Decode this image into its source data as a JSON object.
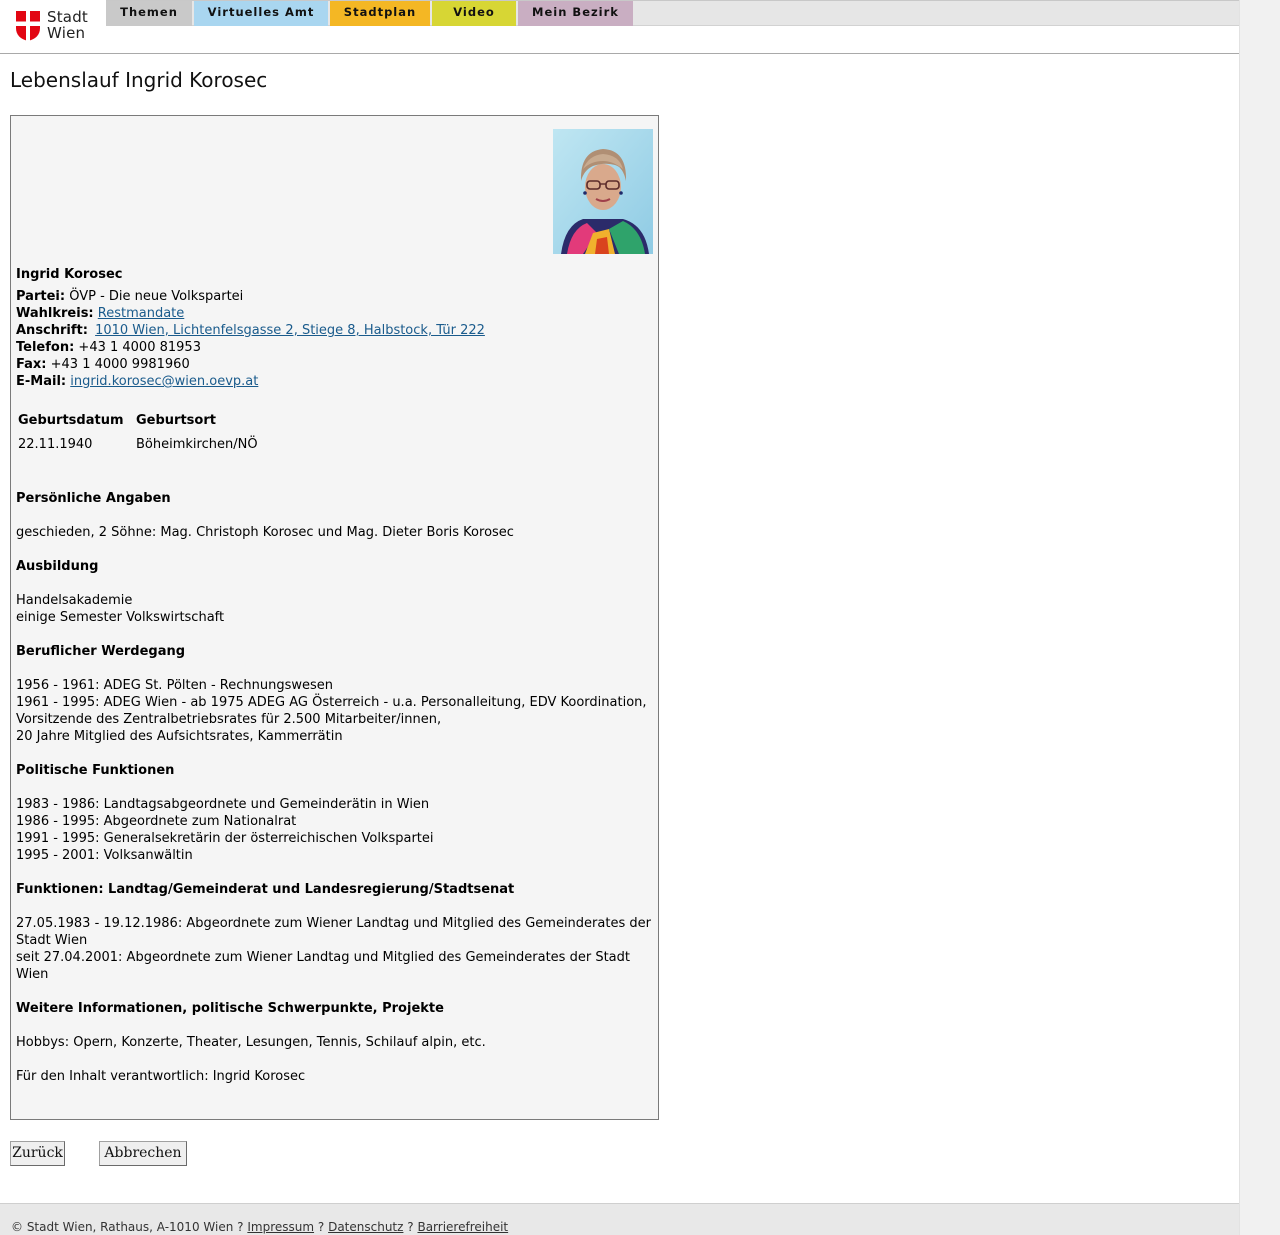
{
  "header": {
    "logo_text": [
      "Stadt",
      "Wien"
    ],
    "tabs": [
      {
        "label": "Themen",
        "color": "#c9c9c9"
      },
      {
        "label": "Virtuelles Amt",
        "color": "#a9d6f0"
      },
      {
        "label": "Stadtplan",
        "color": "#f4b724"
      },
      {
        "label": "Video",
        "color": "#d7d634"
      },
      {
        "label": "Mein Bezirk",
        "color": "#c9aec2"
      }
    ]
  },
  "page_title": "Lebenslauf Ingrid Korosec",
  "profile": {
    "name": "Ingrid Korosec",
    "partei_label": "Partei:",
    "partei": "ÖVP - Die neue Volkspartei",
    "wahlkreis_label": "Wahlkreis:",
    "wahlkreis": "Restmandate",
    "anschrift_label": "Anschrift:",
    "anschrift": "1010 Wien, Lichtenfelsgasse 2, Stiege 8, Halbstock, Tür 222",
    "telefon_label": "Telefon:",
    "telefon": "+43 1 4000 81953",
    "fax_label": "Fax:",
    "fax": "+43 1 4000 9981960",
    "email_label": "E-Mail:",
    "email": "ingrid.korosec@wien.oevp.at"
  },
  "birth_table": {
    "headers": [
      "Geburtsdatum",
      "Geburtsort"
    ],
    "row": [
      "22.11.1940",
      "Böheimkirchen/NÖ"
    ]
  },
  "sections": {
    "personal": {
      "heading": "Persönliche Angaben",
      "lines": [
        "geschieden, 2 Söhne: Mag. Christoph Korosec und Mag. Dieter Boris Korosec"
      ]
    },
    "education": {
      "heading": "Ausbildung",
      "lines": [
        "Handelsakademie",
        "einige Semester Volkswirtschaft"
      ]
    },
    "career": {
      "heading": "Beruflicher Werdegang",
      "lines": [
        "1956 - 1961: ADEG St. Pölten - Rechnungswesen",
        "1961 - 1995: ADEG Wien - ab 1975 ADEG AG Österreich - u.a. Personalleitung, EDV Koordination,",
        "Vorsitzende des Zentralbetriebsrates für 2.500 Mitarbeiter/innen,",
        "20 Jahre Mitglied des Aufsichtsrates, Kammerrätin"
      ]
    },
    "political": {
      "heading": "Politische Funktionen",
      "lines": [
        "1983 - 1986: Landtagsabgeordnete und Gemeinderätin in Wien",
        "1986 - 1995: Abgeordnete zum Nationalrat",
        "1991 - 1995: Generalsekretärin der österreichischen Volkspartei",
        "1995 - 2001: Volksanwältin"
      ]
    },
    "functions": {
      "heading": "Funktionen: Landtag/Gemeinderat und Landesregierung/Stadtsenat",
      "lines": [
        "27.05.1983 - 19.12.1986: Abgeordnete zum Wiener Landtag und Mitglied des Gemeinderates der",
        "Stadt Wien",
        "seit 27.04.2001: Abgeordnete zum Wiener Landtag und Mitglied des Gemeinderates der Stadt",
        "Wien"
      ]
    },
    "further": {
      "heading": "Weitere Informationen, politische Schwerpunkte, Projekte",
      "lines": [
        "Hobbys: Opern, Konzerte, Theater, Lesungen, Tennis, Schilauf alpin, etc."
      ]
    },
    "responsible": "Für den Inhalt verantwortlich: Ingrid Korosec"
  },
  "buttons": {
    "back": "Zurück",
    "cancel": "Abbrechen"
  },
  "footer": {
    "copyright": "© Stadt Wien, Rathaus, A-1010 Wien",
    "sep": "?",
    "links": [
      "Impressum",
      "Datenschutz",
      "Barrierefreiheit"
    ]
  },
  "colors": {
    "logo_red": "#e20613",
    "link": "#1a5b8c"
  }
}
